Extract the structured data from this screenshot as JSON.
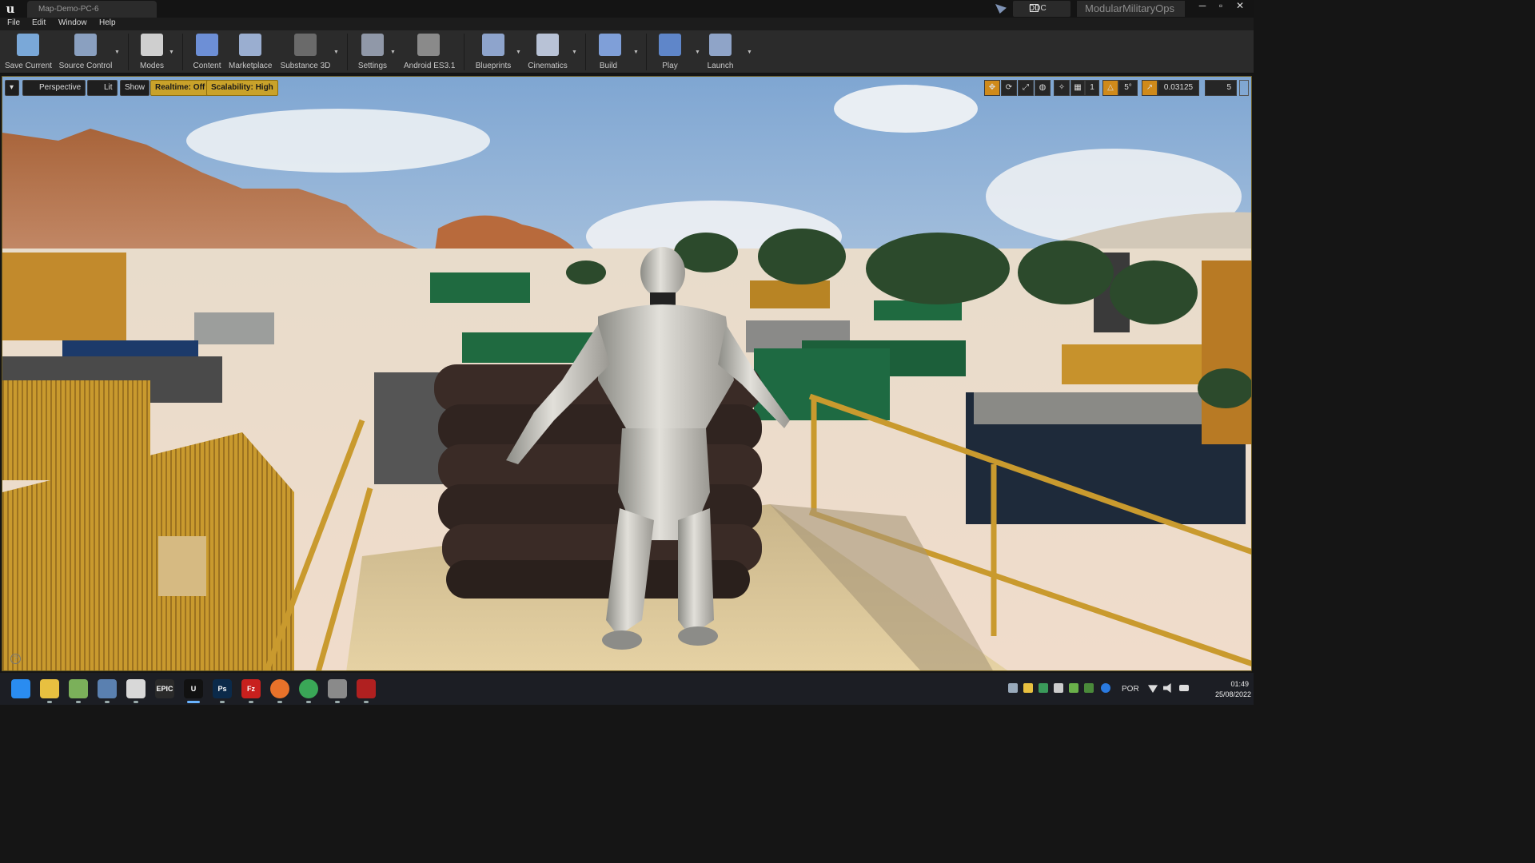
{
  "window": {
    "doc_tab": "Map-Demo-PC-6",
    "ddc_label": "DDC",
    "project_name": "ModularMilitaryOps",
    "controls": [
      "─",
      "▫",
      "✕"
    ]
  },
  "menu": [
    "File",
    "Edit",
    "Window",
    "Help"
  ],
  "toolbar": {
    "items": [
      {
        "label": "Save Current",
        "icon": "save-icon",
        "color": "#7aa8d8"
      },
      {
        "label": "Source Control",
        "icon": "source-control-icon",
        "color": "#8aa0c0"
      },
      {
        "label": "Modes",
        "icon": "modes-icon",
        "color": "#cfcfcf"
      },
      {
        "label": "Content",
        "icon": "content-icon",
        "color": "#6d8fd6"
      },
      {
        "label": "Marketplace",
        "icon": "marketplace-icon",
        "color": "#9aaed0"
      },
      {
        "label": "Substance 3D",
        "icon": "substance-icon",
        "color": "#6a6a6a"
      },
      {
        "label": "Settings",
        "icon": "settings-icon",
        "color": "#9098a8"
      },
      {
        "label": "Android ES3.1",
        "icon": "android-icon",
        "color": "#8a8a8a"
      },
      {
        "label": "Blueprints",
        "icon": "blueprints-icon",
        "color": "#8ea4cc"
      },
      {
        "label": "Cinematics",
        "icon": "cinematics-icon",
        "color": "#b8c2d6"
      },
      {
        "label": "Build",
        "icon": "build-icon",
        "color": "#7f9fd8"
      },
      {
        "label": "Play",
        "icon": "play-icon",
        "color": "#5f86c9"
      },
      {
        "label": "Launch",
        "icon": "launch-icon",
        "color": "#8fa4c8"
      }
    ]
  },
  "viewport": {
    "left_controls": [
      "▾",
      "Perspective",
      "Lit",
      "Show",
      "Realtime: Off",
      "Scalability: High"
    ],
    "right_values": {
      "angle_snap": "5°",
      "scale_snap": "0.03125",
      "camera_speed": "5",
      "grid_snap": "1"
    }
  },
  "taskbar": {
    "apps": [
      {
        "name": "start-icon",
        "label": "",
        "color": "#2a8cf0"
      },
      {
        "name": "explorer-icon",
        "label": "",
        "color": "#e8c040"
      },
      {
        "name": "notepad-icon",
        "label": "",
        "color": "#7bb05a"
      },
      {
        "name": "photos-icon",
        "label": "",
        "color": "#5a80b0"
      },
      {
        "name": "media-icon",
        "label": "",
        "color": "#d8d8d8"
      },
      {
        "name": "epic-games-icon",
        "label": "EPIC",
        "color": "#2a2a2a"
      },
      {
        "name": "unreal-icon",
        "label": "U",
        "color": "#111"
      },
      {
        "name": "photoshop-icon",
        "label": "Ps",
        "color": "#0b2a4a"
      },
      {
        "name": "filezilla-icon",
        "label": "Fz",
        "color": "#c8201e"
      },
      {
        "name": "firefox-icon",
        "label": "",
        "color": "#e8722a"
      },
      {
        "name": "chrome-icon",
        "label": "",
        "color": "#3aa757"
      },
      {
        "name": "game-icon",
        "label": "",
        "color": "#8a8a8a"
      },
      {
        "name": "app-red-icon",
        "label": "",
        "color": "#b02020"
      }
    ],
    "language": "POR",
    "time": "01:49",
    "date": "25/08/2022"
  }
}
